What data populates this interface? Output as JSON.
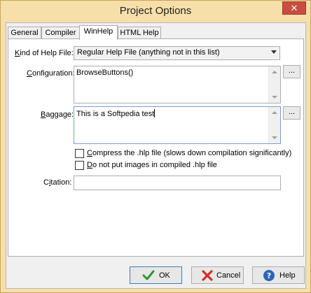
{
  "window": {
    "title": "Project Options",
    "close_glyph": "✕"
  },
  "tabs": [
    {
      "label": "General",
      "active": false
    },
    {
      "label": "Compiler",
      "active": false
    },
    {
      "label": "WinHelp",
      "active": true
    },
    {
      "label": "HTML Help",
      "active": false
    }
  ],
  "form": {
    "kind_label_prefix": "",
    "kind_label_mnemonic": "K",
    "kind_label_rest": "ind of Help File:",
    "kind_value": "Regular Help File (anything not in this list)",
    "configuration_label_prefix": "",
    "configuration_label_mnemonic": "C",
    "configuration_label_rest": "onfiguration:",
    "configuration_value": "BrowseButtons()",
    "configuration_button": "...",
    "baggage_label_prefix": "",
    "baggage_label_mnemonic": "B",
    "baggage_label_rest": "aggage:",
    "baggage_value": "This is a Softpedia test",
    "baggage_button": "...",
    "compress_label_prefix": "",
    "compress_label_mnemonic": "C",
    "compress_label_rest": "ompress the .hlp file (slows down compilation significantly)",
    "compress_checked": false,
    "noimages_label_prefix": "",
    "noimages_label_mnemonic": "D",
    "noimages_label_rest": "o not put images in compiled .hlp file",
    "noimages_checked": false,
    "citation_label_prefix": "C",
    "citation_label_mnemonic": "i",
    "citation_label_rest": "tation:",
    "citation_value": ""
  },
  "buttons": {
    "ok": "OK",
    "cancel": "Cancel",
    "help": "Help"
  },
  "icons": {
    "ok": "check-icon",
    "cancel": "x-icon",
    "help": "question-icon"
  },
  "colors": {
    "title_bar": "#f7dfa9",
    "close_button": "#c74d3d",
    "ok_icon": "#2e9a2e",
    "cancel_icon": "#d0302a",
    "help_icon": "#2a66b8"
  }
}
